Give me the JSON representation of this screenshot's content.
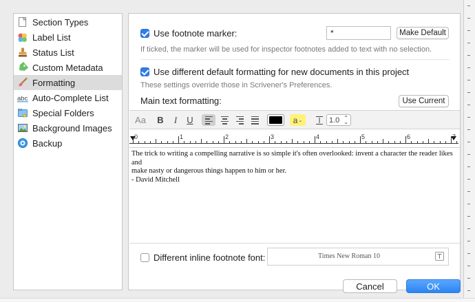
{
  "sidebar": {
    "items": [
      {
        "label": "Section Types",
        "icon": "section-types-icon"
      },
      {
        "label": "Label List",
        "icon": "label-list-icon"
      },
      {
        "label": "Status List",
        "icon": "status-stamp-icon"
      },
      {
        "label": "Custom Metadata",
        "icon": "tag-icon"
      },
      {
        "label": "Formatting",
        "icon": "paintbrush-icon",
        "selected": true
      },
      {
        "label": "Auto-Complete List",
        "icon": "autocomplete-abc-icon"
      },
      {
        "label": "Special Folders",
        "icon": "special-folder-icon"
      },
      {
        "label": "Background Images",
        "icon": "image-icon"
      },
      {
        "label": "Backup",
        "icon": "backup-icon"
      }
    ]
  },
  "footnote_marker": {
    "label": "Use footnote marker:",
    "checked": true,
    "value": "*",
    "make_default": "Make Default",
    "hint": "If ticked, the marker will be used for inspector footnotes added to text with no selection."
  },
  "default_formatting": {
    "label": "Use different default formatting for new documents in this project",
    "checked": true,
    "hint": "These settings override those in Scrivener's Preferences."
  },
  "main_text": {
    "label": "Main text formatting:",
    "use_current": "Use Current"
  },
  "format_bar": {
    "font_button": "Aa",
    "bold": "B",
    "italic": "I",
    "underline": "U",
    "text_color": "#000000",
    "highlight_label": "a",
    "highlight_color": "#fff27a",
    "line_spacing": "1.0"
  },
  "ruler": {
    "numbers": [
      "0",
      "1",
      "2",
      "3",
      "4",
      "5",
      "6",
      "7"
    ]
  },
  "sample_text": {
    "line1": "The trick to writing a compelling narrative is so simple it's often overlooked: invent a character the reader likes and",
    "line2": "make nasty or dangerous things happen to him or her.",
    "line3": "- David Mitchell"
  },
  "inline_footnote": {
    "label": "Different inline footnote font:",
    "checked": false,
    "font_value": "Times New Roman 10"
  },
  "actions": {
    "cancel": "Cancel",
    "ok": "OK"
  }
}
